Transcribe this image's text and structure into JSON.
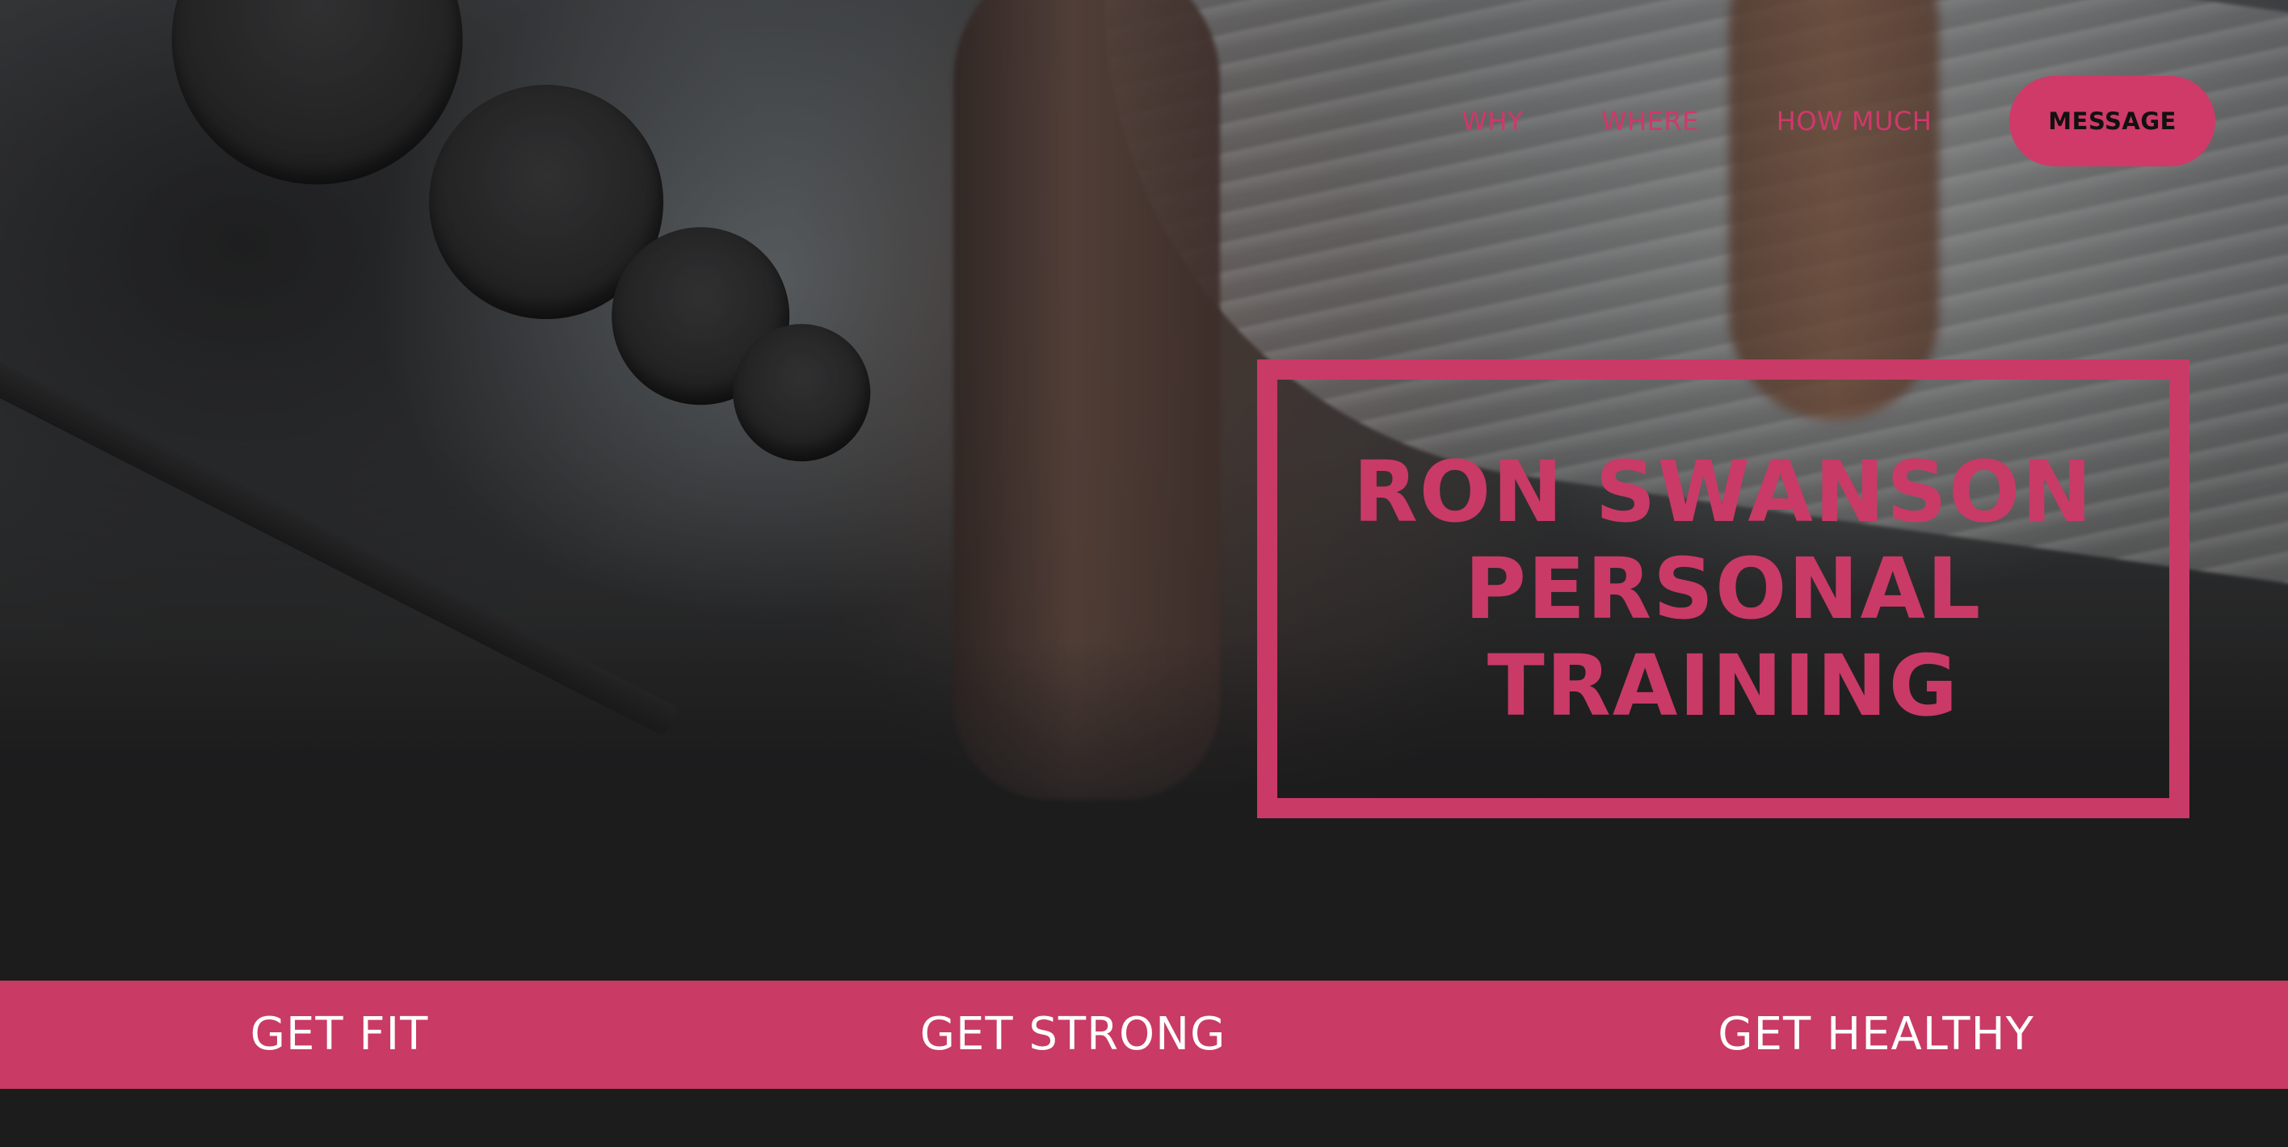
{
  "nav": {
    "links": [
      "WHY",
      "WHERE",
      "HOW MUCH"
    ],
    "cta_label": "MESSAGE"
  },
  "hero": {
    "title_lines": [
      "RON SWANSON",
      "PERSONAL",
      "TRAINING"
    ]
  },
  "taglines": [
    "GET FIT",
    "GET STRONG",
    "GET HEALTHY"
  ],
  "colors": {
    "accent": "#c93a67",
    "background": "#1c1c1d",
    "tagline_text": "#ffffff",
    "button_text": "#111111"
  },
  "icons": []
}
